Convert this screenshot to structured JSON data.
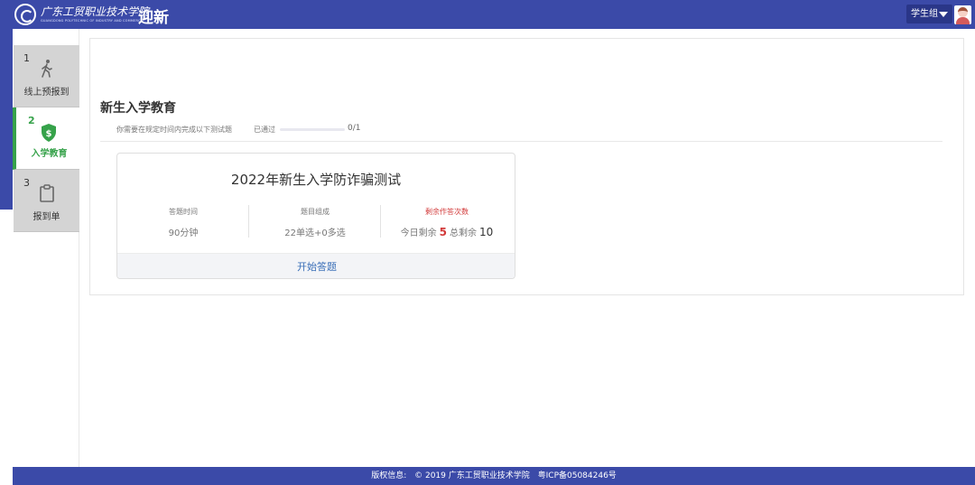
{
  "header": {
    "school_name": "广东工贸职业技术学院",
    "school_name_en": "GUANGDONG POLYTECHNIC OF INDUSTRY AND COMMERCE",
    "app_title": "迎新",
    "user_label": "学生组",
    "brand_color": "#3b4aa8"
  },
  "sidebar": {
    "steps": [
      {
        "num": "1",
        "label": "线上预报到",
        "icon": "walking-person-icon",
        "active": false
      },
      {
        "num": "2",
        "label": "入学教育",
        "icon": "shield-dollar-icon",
        "active": true
      },
      {
        "num": "3",
        "label": "报到单",
        "icon": "clipboard-icon",
        "active": false
      }
    ],
    "active_color": "#36a24a"
  },
  "main": {
    "title": "新生入学教育",
    "instructions": "你需要在规定时间内完成以下测试题",
    "passed_label": "已通过",
    "progress_text": "0/1",
    "progress_fraction": 0
  },
  "quiz": {
    "title": "2022年新生入学防诈骗测试",
    "time_label": "答题时间",
    "time_value": "90分钟",
    "composition_label": "题目组成",
    "composition_value": "22单选+0多选",
    "remaining_label": "剩余作答次数",
    "today_label": "今日剩余",
    "today_value": "5",
    "total_label": "总剩余",
    "total_value": "10",
    "start_label": "开始答题"
  },
  "footer": {
    "copyright_label": "版权信息:",
    "copyright_text": "© 2019 广东工贸职业技术学院",
    "icp": "粤ICP备05084246号"
  }
}
